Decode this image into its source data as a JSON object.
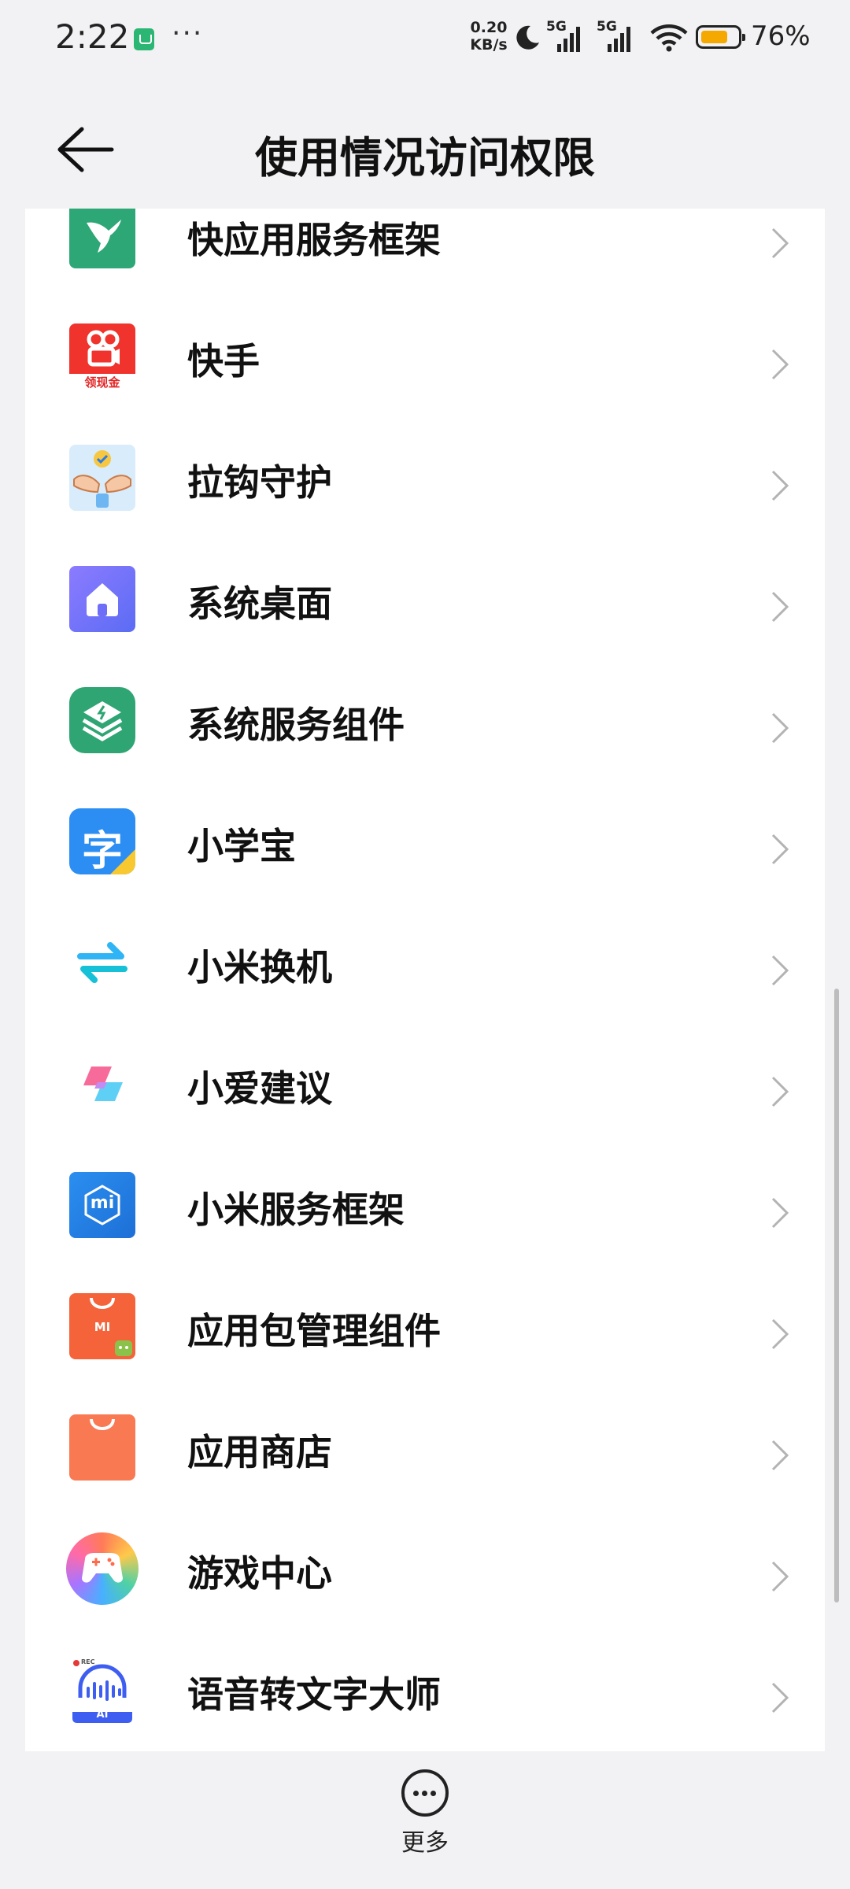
{
  "status_bar": {
    "time": "2:22",
    "dots": "···",
    "net_speed_value": "0.20",
    "net_speed_unit": "KB/s",
    "signal1_label": "5G",
    "signal2_label": "5G",
    "battery_percent": "76%",
    "battery_level": 0.76
  },
  "header": {
    "title": "使用情况访问权限"
  },
  "apps": [
    {
      "label": "快应用服务框架",
      "icon": "hummingbird-icon"
    },
    {
      "label": "快手",
      "icon": "kuaishou-icon",
      "icon_badge": "领现金"
    },
    {
      "label": "拉钩守护",
      "icon": "pinky-promise-icon"
    },
    {
      "label": "系统桌面",
      "icon": "home-icon"
    },
    {
      "label": "系统服务组件",
      "icon": "layers-icon"
    },
    {
      "label": "小学宝",
      "icon": "study-icon",
      "icon_glyph": "字"
    },
    {
      "label": "小米换机",
      "icon": "swap-arrows-icon"
    },
    {
      "label": "小爱建议",
      "icon": "xiaoai-icon"
    },
    {
      "label": "小米服务框架",
      "icon": "mi-service-icon",
      "icon_glyph": "mi"
    },
    {
      "label": "应用包管理组件",
      "icon": "package-manager-icon",
      "icon_glyph": "MI"
    },
    {
      "label": "应用商店",
      "icon": "app-store-icon"
    },
    {
      "label": "游戏中心",
      "icon": "game-center-icon"
    },
    {
      "label": "语音转文字大师",
      "icon": "voice-to-text-icon",
      "icon_badge": "REC",
      "icon_glyph": "AI"
    }
  ],
  "more": {
    "label": "更多"
  },
  "colors": {
    "background": "#f2f2f4",
    "card": "#ffffff",
    "battery_fill": "#f5a800"
  }
}
